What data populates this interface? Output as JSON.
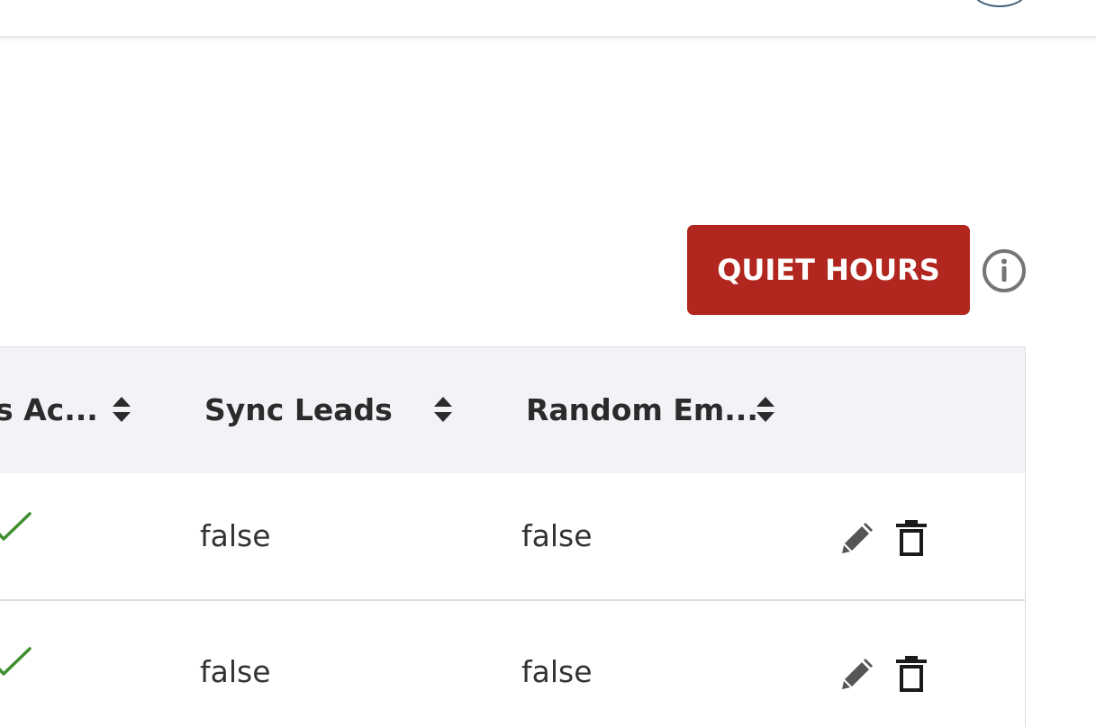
{
  "header": {
    "avatar_icon": "user-avatar-icon"
  },
  "toolbar": {
    "quiet_hours_label": "QUIET HOURS",
    "info_icon": "info-circle-icon",
    "accent_color": "#b1261f"
  },
  "table": {
    "columns": [
      {
        "label": "s Ac...",
        "sort_icon": "sort-icon"
      },
      {
        "label": "Sync Leads",
        "sort_icon": "sort-icon"
      },
      {
        "label": "Random Em...",
        "sort_icon": "sort-icon"
      },
      {
        "label": ""
      }
    ],
    "rows": [
      {
        "active": true,
        "sync_leads": "false",
        "random_email": "false",
        "actions": [
          "edit-icon",
          "trash-icon"
        ]
      },
      {
        "active": true,
        "sync_leads": "false",
        "random_email": "false",
        "actions": [
          "edit-icon",
          "trash-icon"
        ]
      }
    ],
    "check_color": "#3f8f2f",
    "header_bg": "#f2f3f7"
  }
}
